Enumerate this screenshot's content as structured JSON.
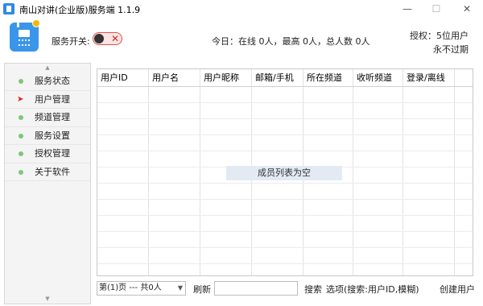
{
  "window": {
    "title": "南山对讲(企业版)服务端 1.1.9",
    "controls": {
      "minimize": "—",
      "maximize": "☐",
      "close": "✕"
    }
  },
  "header": {
    "service_switch_label": "服务开关:",
    "service_on": false,
    "today_stats": "今日：在线 0人，最高 0人，总人数 0人",
    "license_line1": "授权：5位用户",
    "license_line2": "永不过期"
  },
  "sidebar": {
    "scroll_up": "▲",
    "scroll_down": "▼",
    "items": [
      {
        "label": "服务状态",
        "icon": "status-dot",
        "selected": false
      },
      {
        "label": "用户管理",
        "icon": "selected-arrow",
        "selected": true
      },
      {
        "label": "频道管理",
        "icon": "status-dot",
        "selected": false
      },
      {
        "label": "服务设置",
        "icon": "status-dot",
        "selected": false
      },
      {
        "label": "授权管理",
        "icon": "status-dot",
        "selected": false
      },
      {
        "label": "关于软件",
        "icon": "status-dot",
        "selected": false
      }
    ]
  },
  "table": {
    "columns": [
      "用户ID",
      "用户名",
      "用户昵称",
      "邮箱/手机",
      "所在频道",
      "收听频道",
      "登录/离线"
    ],
    "rows": [],
    "empty_message": "成员列表为空"
  },
  "footer": {
    "page_select": "第(1)页 --- 共0人",
    "refresh_label": "刷新",
    "search_value": "",
    "search_label": "搜索",
    "options_label": "选项(搜索:用户ID,模糊)",
    "create_user_label": "创建用户"
  },
  "colors": {
    "accent": "#3b95ea",
    "toggle_off_border": "#d9534f",
    "selected_arrow": "#e02020",
    "status_dot": "#7cc77a"
  }
}
